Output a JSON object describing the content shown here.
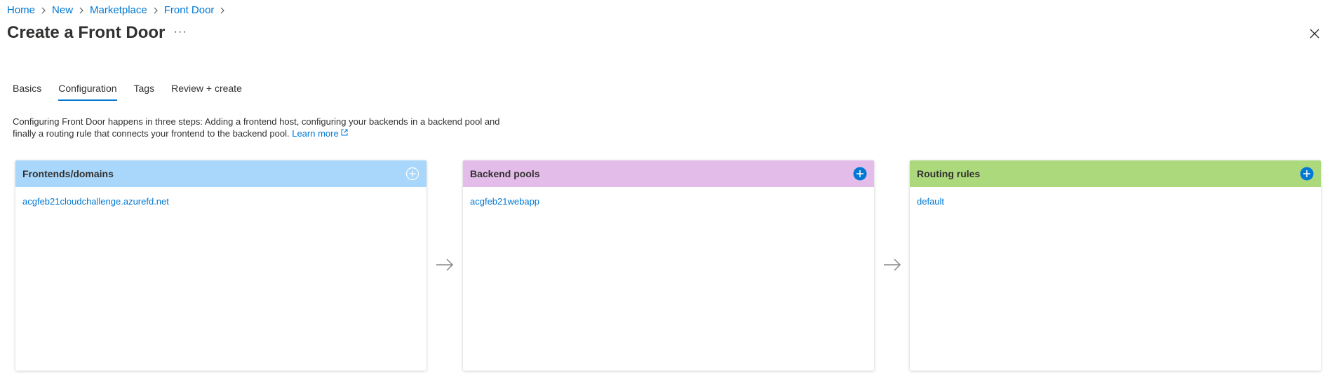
{
  "breadcrumb": [
    {
      "label": "Home"
    },
    {
      "label": "New"
    },
    {
      "label": "Marketplace"
    },
    {
      "label": "Front Door"
    }
  ],
  "header": {
    "title": "Create a Front Door",
    "more_label": "···"
  },
  "tabs": [
    {
      "label": "Basics"
    },
    {
      "label": "Configuration",
      "active": true
    },
    {
      "label": "Tags"
    },
    {
      "label": "Review + create"
    }
  ],
  "description": {
    "text": "Configuring Front Door happens in three steps: Adding a frontend host, configuring your backends in a backend pool and finally a routing rule that connects your frontend to the backend pool.",
    "link_label": "Learn more"
  },
  "cards": {
    "frontends": {
      "title": "Frontends/domains",
      "header_color": "#a9d7fb",
      "items": [
        "acgfeb21cloudchallenge.azurefd.net"
      ],
      "add_icon": "add-circle-outline-icon"
    },
    "backends": {
      "title": "Backend pools",
      "header_color": "#e3bce9",
      "items": [
        "acgfeb21webapp"
      ],
      "add_icon": "add-circle-filled-icon"
    },
    "routing": {
      "title": "Routing rules",
      "header_color": "#add97d",
      "items": [
        "default"
      ],
      "add_icon": "add-circle-filled-icon"
    }
  },
  "colors": {
    "accent": "#0078d4",
    "text": "#323130",
    "arrow": "#8a8886"
  }
}
